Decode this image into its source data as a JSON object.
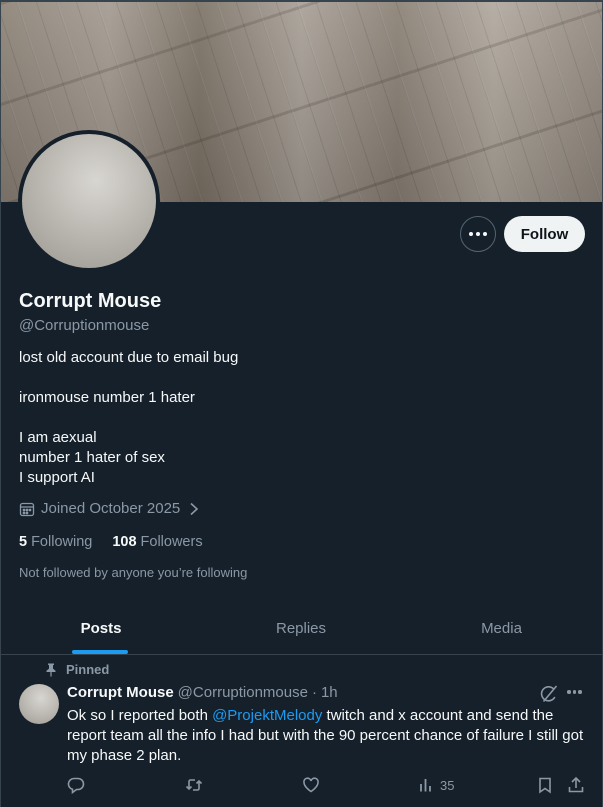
{
  "profile": {
    "name": "Corrupt Mouse",
    "handle": "@Corruptionmouse",
    "bio_lines": [
      "lost old account due to email bug",
      "",
      "ironmouse number 1 hater",
      "",
      "I am aexual",
      "number 1 hater of sex",
      "I support AI"
    ],
    "joined": "Joined October 2025",
    "following_count": "5",
    "following_label": "Following",
    "followers_count": "108",
    "followers_label": "Followers",
    "not_followed_text": "Not followed by anyone you’re following",
    "follow_button_label": "Follow"
  },
  "tabs": [
    {
      "label": "Posts",
      "active": true
    },
    {
      "label": "Replies",
      "active": false
    },
    {
      "label": "Media",
      "active": false
    }
  ],
  "post": {
    "pinned_label": "Pinned",
    "author_name": "Corrupt Mouse",
    "author_handle": "@Corruptionmouse",
    "separator": "·",
    "time": "1h",
    "text_before": "Ok so I reported both ",
    "mention": "@ProjektMelody",
    "text_after": " twitch and x account and send the report team all the info I had but with the 90 percent chance of failure I still got my phase 2 plan.",
    "views": "35"
  },
  "colors": {
    "background": "#15202b",
    "accent": "#1d9bf0",
    "muted_text": "#8b98a5",
    "follow_button_bg": "#eff3f4"
  }
}
